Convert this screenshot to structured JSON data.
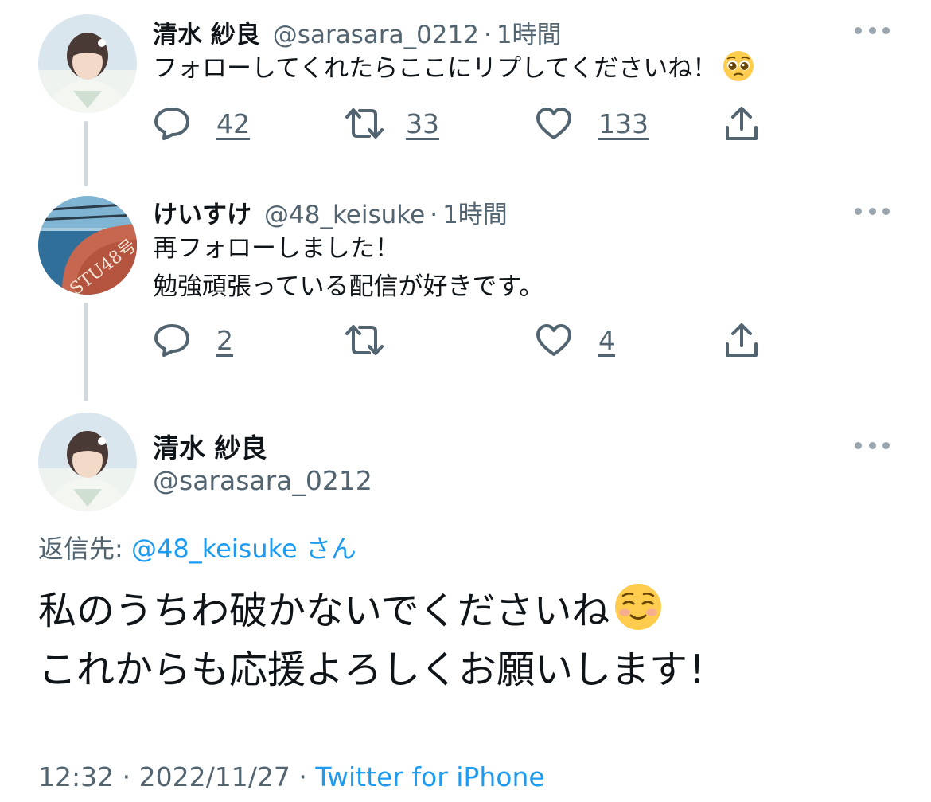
{
  "thread": [
    {
      "name": "清水 紗良",
      "handle": "@sarasara_0212",
      "separator": "·",
      "time": "1時間",
      "text_lines": [
        "フォローしてくれたらここにリプしてくださいね！"
      ],
      "trailing_emoji": "pleading-face-emoji",
      "counts": {
        "replies": "42",
        "retweets": "33",
        "likes": "133"
      }
    },
    {
      "name": "けいすけ",
      "handle": "@48_keisuke",
      "separator": "·",
      "time": "1時間",
      "text_lines": [
        "再フォローしました！",
        "勉強頑張っている配信が好きです。"
      ],
      "avatar_text": "STU48号",
      "counts": {
        "replies": "2",
        "retweets": "",
        "likes": "4"
      }
    }
  ],
  "main": {
    "name": "清水 紗良",
    "handle": "@sarasara_0212",
    "reply_label": "返信先:",
    "reply_mention": "@48_keisuke",
    "reply_suffix": "さん",
    "text_lines": [
      "私のうちわ破かないでくださいね",
      "これからも応援よろしくお願いします！"
    ],
    "trailing_emoji": "smiling-face-emoji",
    "time": "12:32",
    "date": "2022/11/27",
    "separator": "·",
    "source": "Twitter for iPhone"
  },
  "icons": [
    "reply-icon",
    "retweet-icon",
    "like-icon",
    "share-icon",
    "more-icon"
  ],
  "colors": {
    "link": "#1d9bf0",
    "secondary": "#536471",
    "text": "#0f1419",
    "thread_line": "#cfd9de"
  }
}
